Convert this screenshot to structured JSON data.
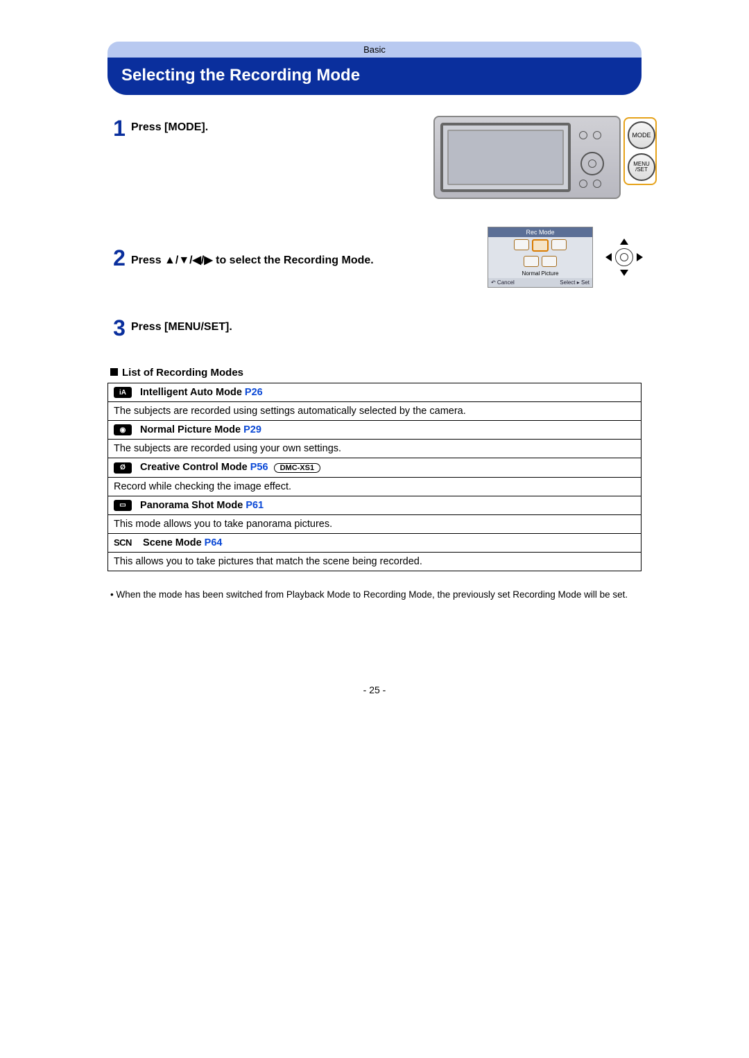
{
  "top_label": "Basic",
  "title": "Selecting the Recording Mode",
  "steps": {
    "s1": {
      "num": "1",
      "text": "Press [MODE]."
    },
    "s2": {
      "num": "2",
      "prefix": "Press ",
      "arrows": "▲/▼/◀/▶",
      "suffix": " to select the Recording Mode."
    },
    "s3": {
      "num": "3",
      "text": "Press [MENU/SET]."
    }
  },
  "camera_buttons": {
    "mode": "MODE",
    "menu": "MENU\n/SET"
  },
  "screen_mock": {
    "title": "Rec Mode",
    "caption": "Normal Picture",
    "cancel": "↶ Cancel",
    "select": "Select ▸ Set"
  },
  "list_heading": "List of Recording Modes",
  "modes": {
    "m1": {
      "icon": "iA",
      "name": "Intelligent Auto Mode ",
      "page": "P26",
      "desc": "The subjects are recorded using settings automatically selected by the camera."
    },
    "m2": {
      "icon": "◉",
      "name": "Normal Picture Mode ",
      "page": "P29",
      "desc": "The subjects are recorded using your own settings."
    },
    "m3": {
      "icon": "Ø",
      "name": "Creative Control Mode ",
      "page": "P56",
      "badge": "DMC-XS1",
      "desc": "Record while checking the image effect."
    },
    "m4": {
      "icon": "▭",
      "name": "Panorama Shot Mode ",
      "page": "P61",
      "desc": "This mode allows you to take panorama pictures."
    },
    "m5": {
      "icon_text": "SCN",
      "name": "Scene Mode ",
      "page": "P64",
      "desc": "This allows you to take pictures that match the scene being recorded."
    }
  },
  "note": "• When the mode has been switched from Playback Mode to Recording Mode, the previously set Recording Mode will be set.",
  "page_number": "- 25 -"
}
